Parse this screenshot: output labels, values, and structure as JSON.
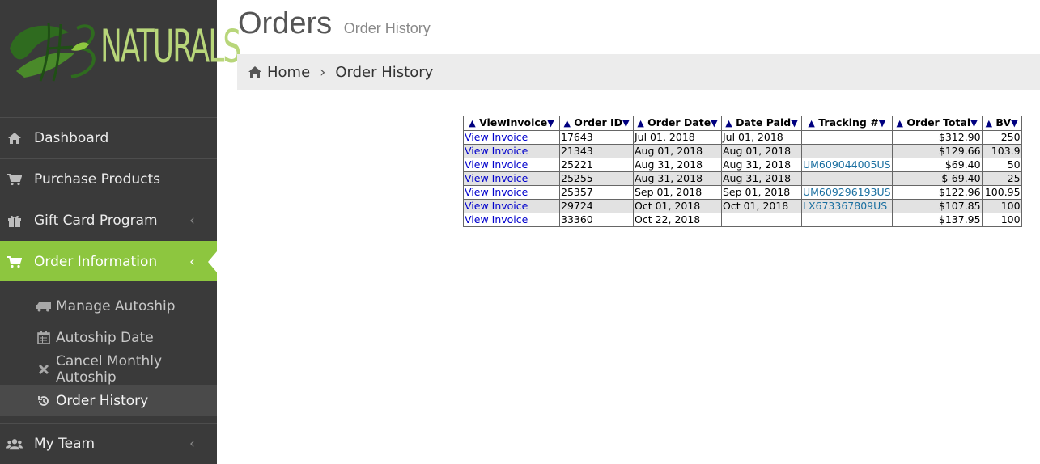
{
  "brand": {
    "logo_text": "NATURALS",
    "logo_mark": "HB"
  },
  "sidebar": {
    "items": [
      {
        "label": "Dashboard",
        "icon": "home-icon"
      },
      {
        "label": "Purchase Products",
        "icon": "cart-icon"
      },
      {
        "label": "Gift Card Program",
        "icon": "gift-icon"
      },
      {
        "label": "Order Information",
        "icon": "cart-icon",
        "active": true
      },
      {
        "label": "My Team",
        "icon": "users-icon"
      }
    ],
    "submenu": [
      {
        "label": "Manage Autoship",
        "icon": "truck-icon"
      },
      {
        "label": "Autoship Date",
        "icon": "calendar-icon"
      },
      {
        "label": "Cancel Monthly Autoship",
        "icon": "close-icon"
      },
      {
        "label": "Order History",
        "icon": "history-icon",
        "active": true
      }
    ],
    "chevron": "‹",
    "accent": "#8dc63f"
  },
  "page": {
    "title": "Orders",
    "subtitle": "Order History"
  },
  "breadcrumb": {
    "home": "Home",
    "sep": "›",
    "current": "Order History"
  },
  "table": {
    "sort_up": "▲",
    "sort_down": "▼",
    "headers": [
      "ViewInvoice",
      "Order ID",
      "Order Date",
      "Date Paid",
      "Tracking #",
      "Order Total",
      "BV"
    ],
    "rows": [
      {
        "invoice": "View Invoice",
        "id": "17643",
        "order_date": "Jul 01, 2018",
        "date_paid": "Jul 01, 2018",
        "tracking": "",
        "total": "$312.90",
        "bv": "250"
      },
      {
        "invoice": "View Invoice",
        "id": "21343",
        "order_date": "Aug 01, 2018",
        "date_paid": "Aug 01, 2018",
        "tracking": "",
        "total": "$129.66",
        "bv": "103.9"
      },
      {
        "invoice": "View Invoice",
        "id": "25221",
        "order_date": "Aug 31, 2018",
        "date_paid": "Aug 31, 2018",
        "tracking": "UM609044005US",
        "total": "$69.40",
        "bv": "50"
      },
      {
        "invoice": "View Invoice",
        "id": "25255",
        "order_date": "Aug 31, 2018",
        "date_paid": "Aug 31, 2018",
        "tracking": "",
        "total": "$-69.40",
        "bv": "-25"
      },
      {
        "invoice": "View Invoice",
        "id": "25357",
        "order_date": "Sep 01, 2018",
        "date_paid": "Sep 01, 2018",
        "tracking": "UM609296193US",
        "total": "$122.96",
        "bv": "100.95"
      },
      {
        "invoice": "View Invoice",
        "id": "29724",
        "order_date": "Oct 01, 2018",
        "date_paid": "Oct 01, 2018",
        "tracking": "LX673367809US",
        "total": "$107.85",
        "bv": "100"
      },
      {
        "invoice": "View Invoice",
        "id": "33360",
        "order_date": "Oct 22, 2018",
        "date_paid": "",
        "tracking": "",
        "total": "$137.95",
        "bv": "100"
      }
    ]
  }
}
